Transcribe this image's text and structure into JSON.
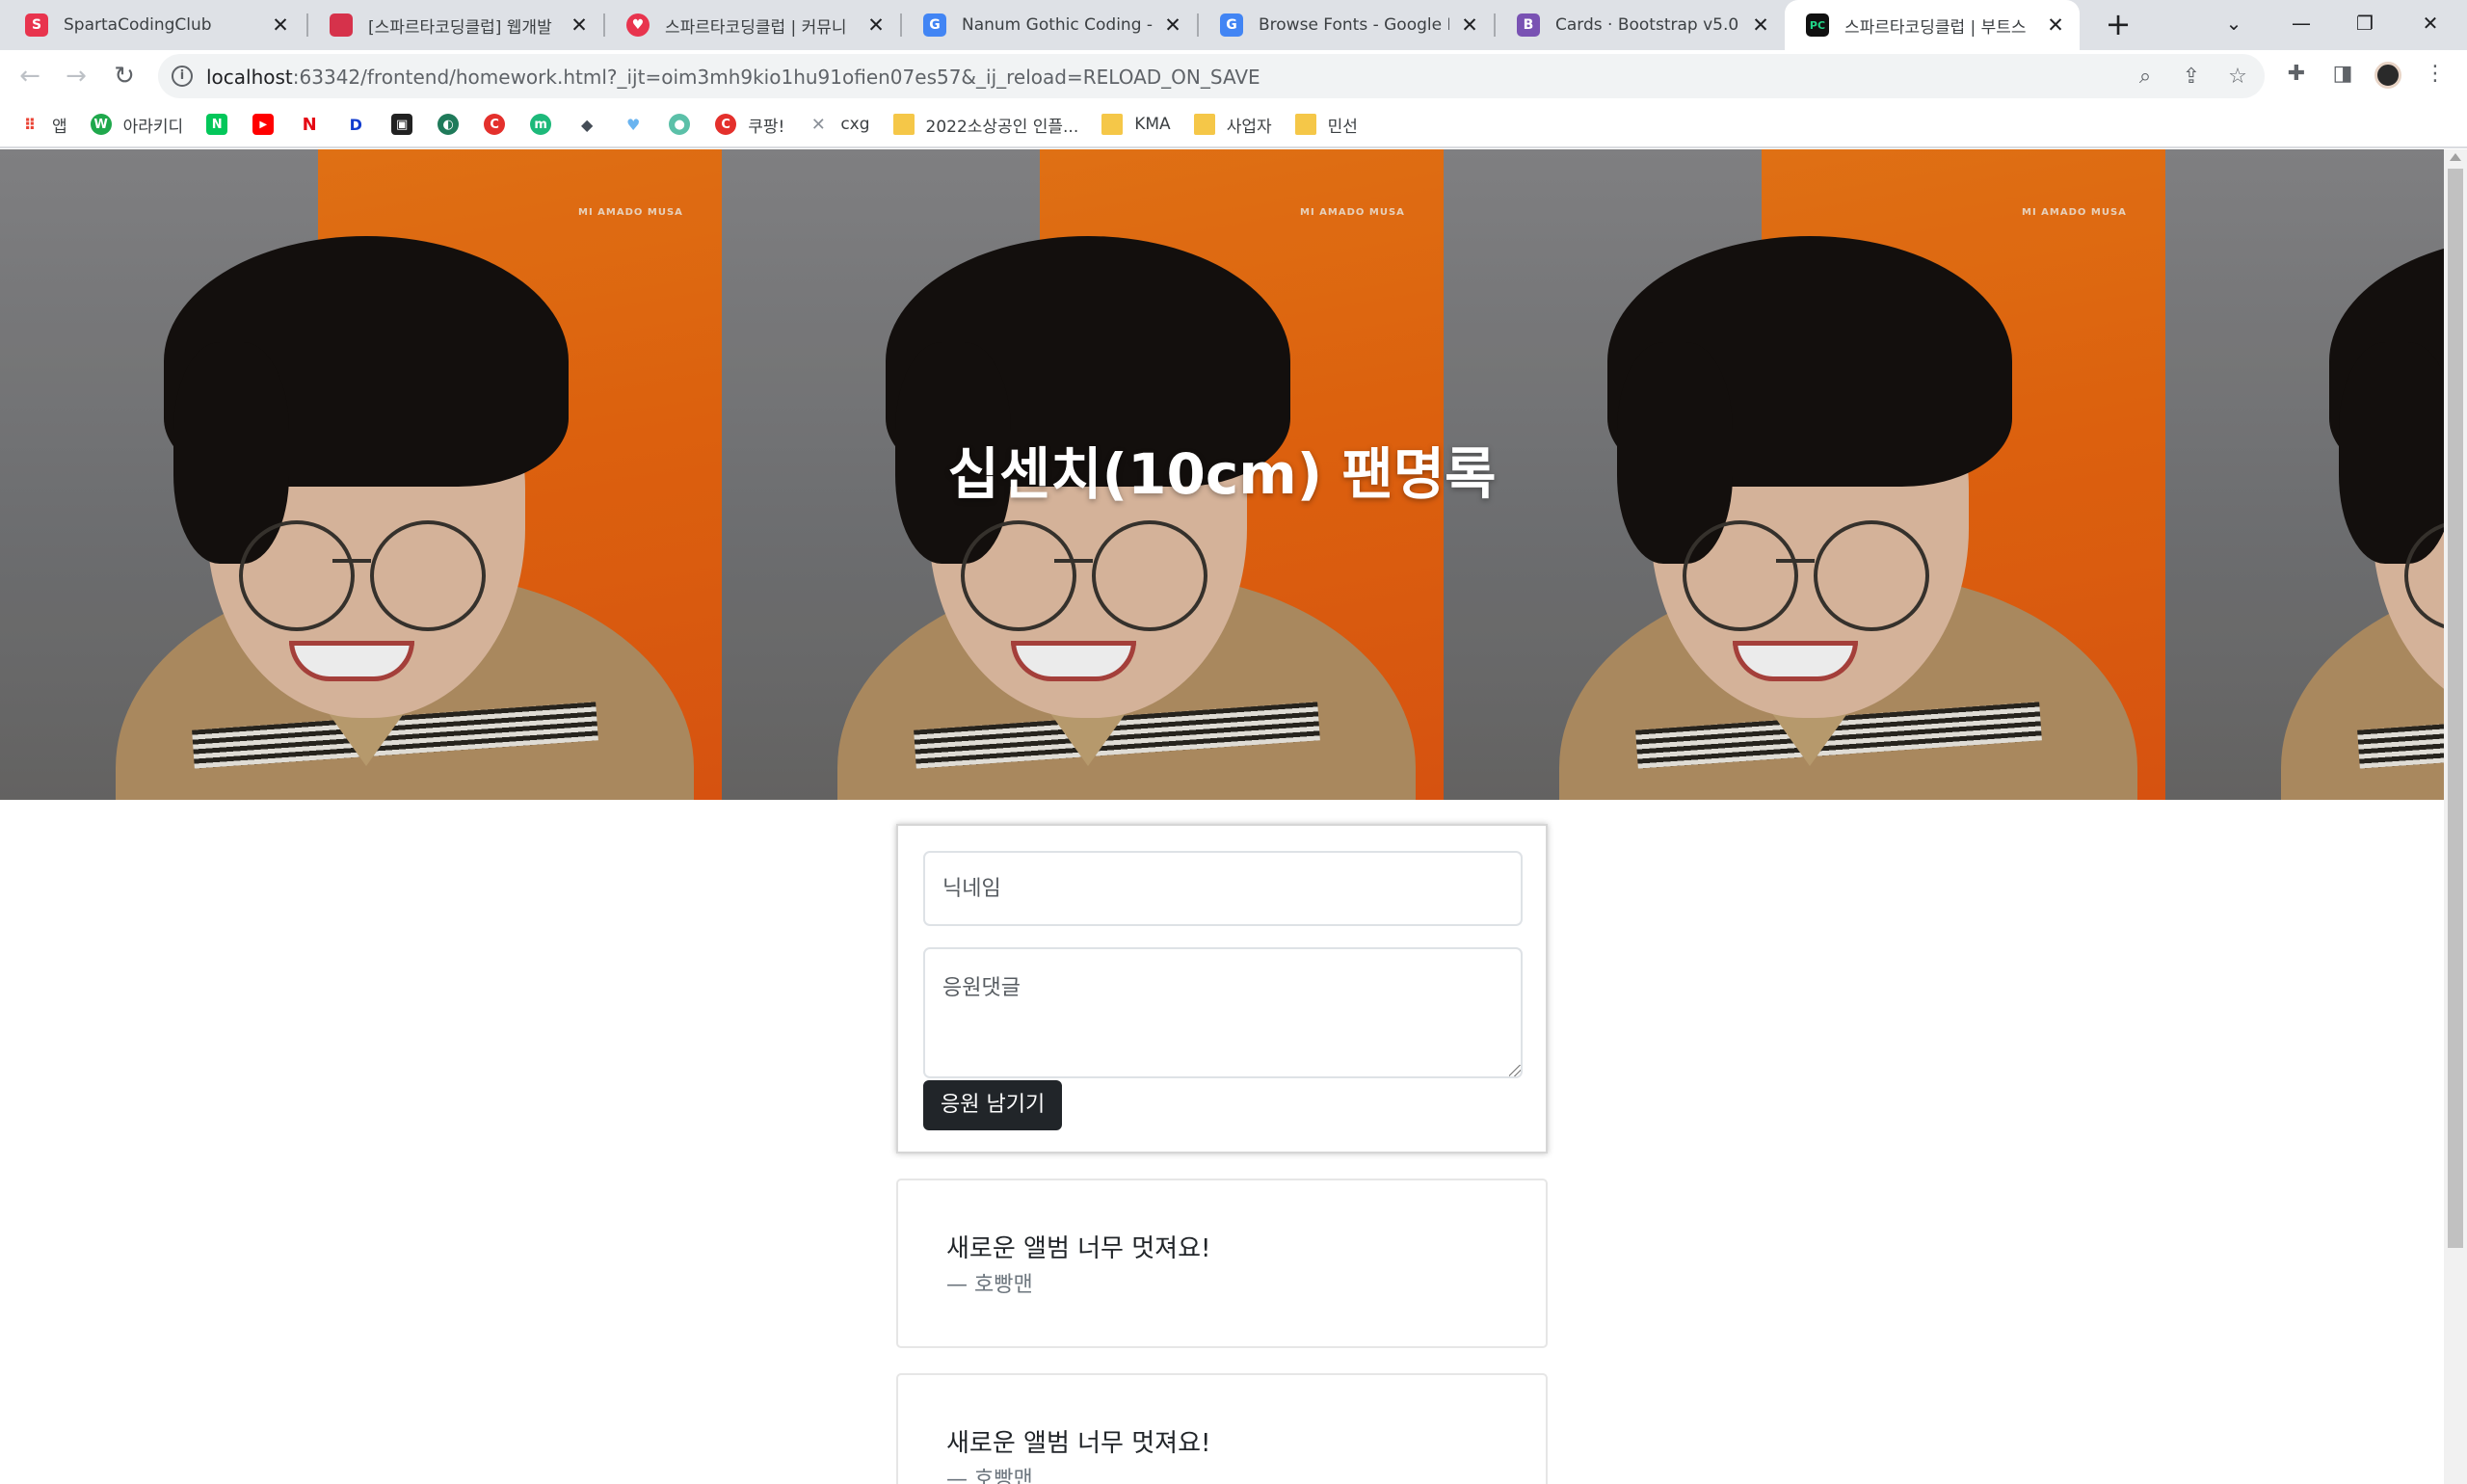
{
  "browser": {
    "tabs": [
      {
        "title": "SpartaCodingClub",
        "icon": "sparta-favicon",
        "color": "#e8344e",
        "glyph": "S"
      },
      {
        "title": "[스파르타코딩클럽] 웹개발",
        "icon": "notebook-favicon",
        "color": "#d6324b",
        "glyph": ""
      },
      {
        "title": "스파르타코딩클럽 | 커뮤니",
        "icon": "heart-favicon",
        "color": "#e8344e",
        "glyph": "♥"
      },
      {
        "title": "Nanum Gothic Coding - G",
        "icon": "google-fonts-favicon",
        "color": "#4285f4",
        "glyph": "G"
      },
      {
        "title": "Browse Fonts - Google Fo",
        "icon": "google-fonts-favicon",
        "color": "#4285f4",
        "glyph": "G"
      },
      {
        "title": "Cards · Bootstrap v5.0",
        "icon": "bootstrap-favicon",
        "color": "#7952b3",
        "glyph": "B"
      },
      {
        "title": "스파르타코딩클럽 | 부트스",
        "icon": "pycharm-favicon",
        "color": "#21d789",
        "glyph": "PC"
      }
    ],
    "url_host": "localhost",
    "url_rest": ":63342/frontend/homework.html?_ijt=oim3mh9kio1hu91ofien07es57&_ij_reload=RELOAD_ON_SAVE",
    "bookmarks": [
      {
        "label": "앱",
        "icon": "apps-grid-icon",
        "color": "#5f6368",
        "glyph": "⋮⋮"
      },
      {
        "label": "아라키디",
        "icon": "arakid-icon",
        "color": "#1fa84c",
        "glyph": "W"
      },
      {
        "label": "",
        "icon": "naver-icon",
        "color": "#03c75a",
        "glyph": "N"
      },
      {
        "label": "",
        "icon": "youtube-icon",
        "color": "#ff0000",
        "glyph": "▶"
      },
      {
        "label": "",
        "icon": "netflix-icon",
        "color": "#e50914",
        "glyph": "N"
      },
      {
        "label": "",
        "icon": "disney-icon",
        "color": "#113ccf",
        "glyph": "D"
      },
      {
        "label": "",
        "icon": "watcha-icon",
        "color": "#222222",
        "glyph": "▣"
      },
      {
        "label": "",
        "icon": "globe-icon",
        "color": "#1f7a5a",
        "glyph": "◐"
      },
      {
        "label": "",
        "icon": "coupang-c-icon",
        "color": "#e4302c",
        "glyph": "C"
      },
      {
        "label": "",
        "icon": "m-circle-icon",
        "color": "#1db97a",
        "glyph": "m"
      },
      {
        "label": "",
        "icon": "layers-icon",
        "color": "#444c56",
        "glyph": "◆"
      },
      {
        "label": "",
        "icon": "balloon-icon",
        "color": "#6ab4f0",
        "glyph": "♥"
      },
      {
        "label": "",
        "icon": "avatar-circle-icon",
        "color": "#5bc0a8",
        "glyph": "●"
      },
      {
        "label": "쿠팡!",
        "icon": "coupang-icon",
        "color": "#e4302c",
        "glyph": "C"
      },
      {
        "label": "cxg",
        "icon": "x-mark-icon",
        "color": "#8a9098",
        "glyph": "✕"
      },
      {
        "label": "2022소상공인 인플...",
        "icon": "folder-icon",
        "color": "#f5c748",
        "glyph": ""
      },
      {
        "label": "KMA",
        "icon": "folder-icon",
        "color": "#f5c748",
        "glyph": ""
      },
      {
        "label": "사업자",
        "icon": "folder-icon",
        "color": "#f5c748",
        "glyph": ""
      },
      {
        "label": "민선",
        "icon": "folder-icon",
        "color": "#f5c748",
        "glyph": ""
      }
    ]
  },
  "page": {
    "hero_title": "십센치(10cm) 팬명록",
    "form": {
      "nickname_placeholder": "닉네임",
      "comment_placeholder": "응원댓글",
      "submit_label": "응원 남기기"
    },
    "comments": [
      {
        "text": "새로운 앨범 너무 멋져요!",
        "author": "— 호빵맨"
      },
      {
        "text": "새로운 앨범 너무 멋져요!",
        "author": "— 호빵맨"
      }
    ]
  },
  "colors": {
    "button_bg": "#212529",
    "poster_orange": "#ef6a10"
  }
}
